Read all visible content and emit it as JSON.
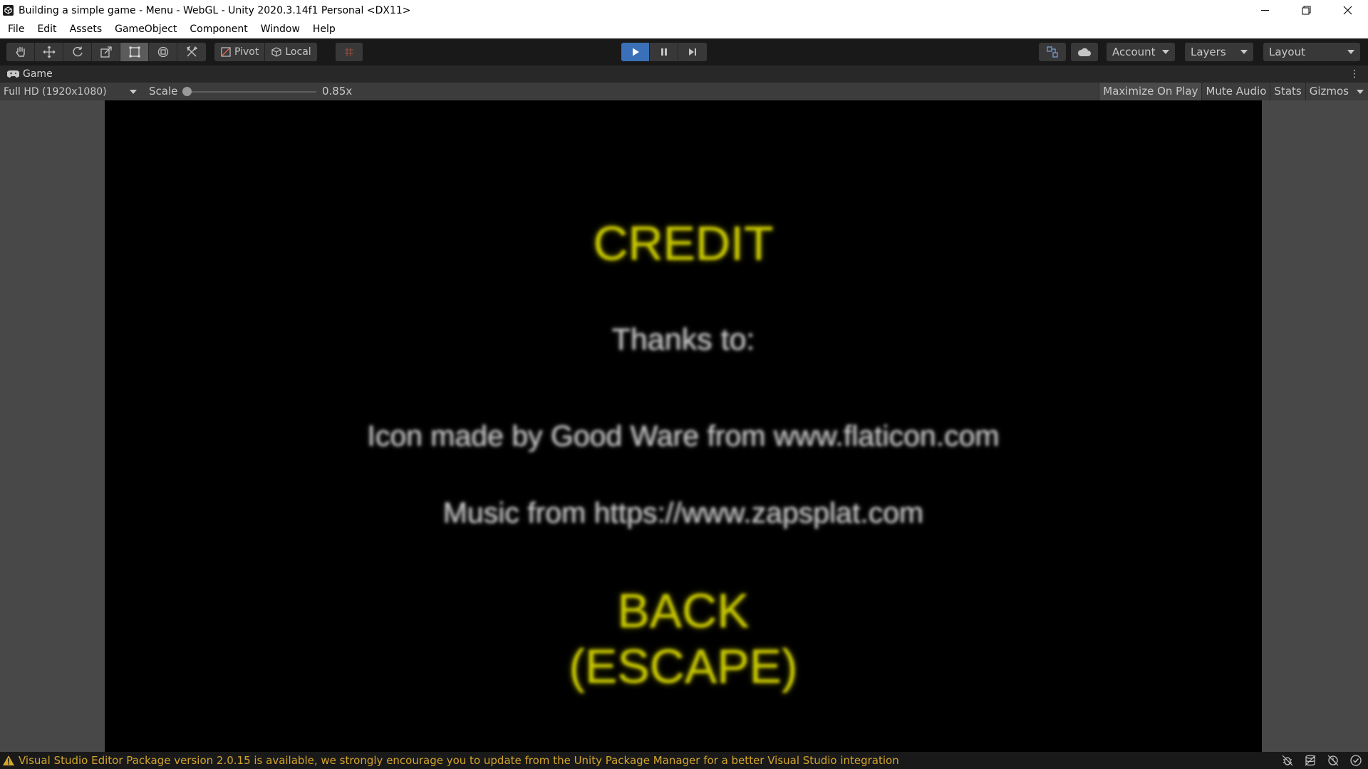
{
  "window": {
    "title": "Building a simple game - Menu - WebGL - Unity 2020.3.14f1 Personal <DX11>",
    "app_icon": "unity-icon",
    "controls": [
      "minimize-icon",
      "restore-icon",
      "close-icon"
    ]
  },
  "menu": {
    "items": [
      "File",
      "Edit",
      "Assets",
      "GameObject",
      "Component",
      "Window",
      "Help"
    ]
  },
  "toolbar": {
    "tools": [
      "hand-tool-icon",
      "move-tool-icon",
      "rotate-tool-icon",
      "scale-tool-icon",
      "rect-tool-icon",
      "transform-tool-icon",
      "custom-tool-icon"
    ],
    "active_tool": "rect-tool-icon",
    "pivot_label": "Pivot",
    "local_label": "Local",
    "play_active": true,
    "account_label": "Account",
    "layers_label": "Layers",
    "layout_label": "Layout",
    "accent_color": "#3a70b8"
  },
  "game_tab": {
    "label": "Game",
    "resolution": "Full HD (1920x1080)",
    "scale_label": "Scale",
    "scale_value": "0.85x",
    "buttons": {
      "maximize": "Maximize On Play",
      "mute": "Mute Audio",
      "stats": "Stats",
      "gizmos": "Gizmos"
    }
  },
  "game_screen": {
    "title": "CREDIT",
    "thanks": "Thanks to:",
    "credit_icons": "Icon made by Good Ware from www.flaticon.com",
    "credit_music": "Music from https://www.zapsplat.com",
    "back_line1": "BACK",
    "back_line2": "(ESCAPE)",
    "highlight_color": "#c6c600",
    "text_color": "#c6c6c6"
  },
  "status": {
    "message": "Visual Studio Editor Package version 2.0.15 is available, we strongly encourage you to update from the Unity Package Manager for a better Visual Studio integration",
    "warning_color": "#d4a52a"
  }
}
